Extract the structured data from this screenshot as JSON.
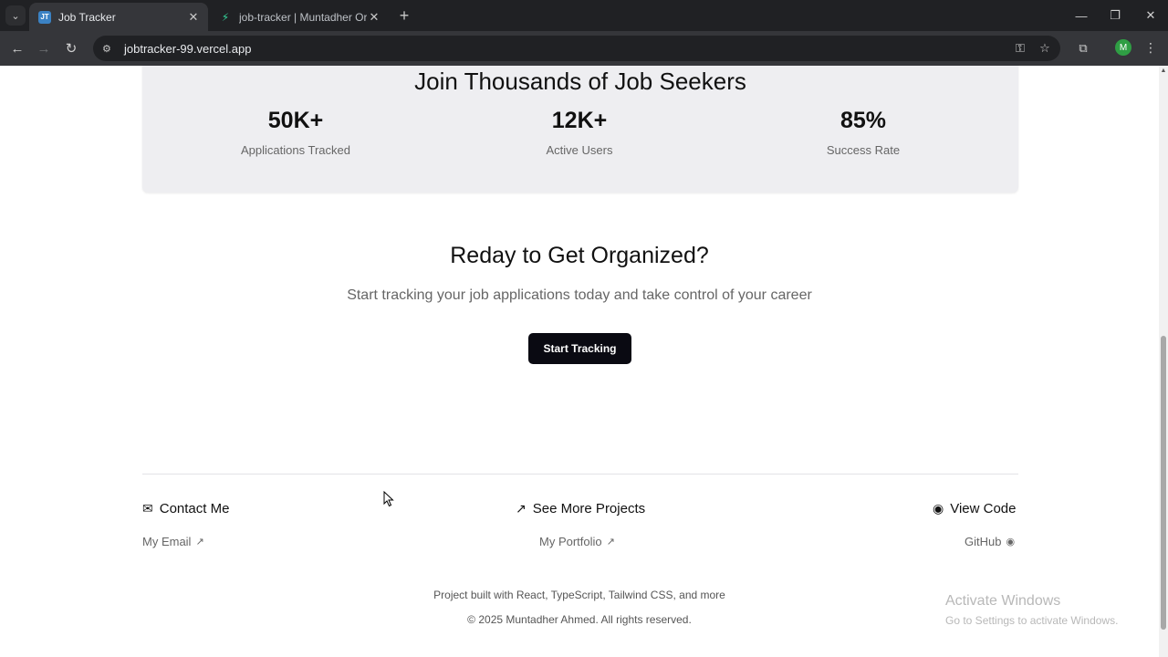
{
  "browser": {
    "tabs": [
      {
        "favicon": "JT",
        "title": "Job Tracker",
        "active": true
      },
      {
        "favicon": "⚡",
        "title": "job-tracker | Muntadher Organi",
        "active": false
      }
    ],
    "url": "jobtracker-99.vercel.app",
    "profile_initial": "M"
  },
  "stats": {
    "title": "Join Thousands of Job Seekers",
    "items": [
      {
        "value": "50K+",
        "label": "Applications Tracked"
      },
      {
        "value": "12K+",
        "label": "Active Users"
      },
      {
        "value": "85%",
        "label": "Success Rate"
      }
    ]
  },
  "cta": {
    "title": "Reday to Get Organized?",
    "subtitle": "Start tracking your job applications today and take control of your career",
    "button": "Start Tracking"
  },
  "footer": {
    "contact": {
      "title": "Contact Me",
      "icon": "mail-icon",
      "link": "My Email"
    },
    "projects": {
      "title": "See More Projects",
      "icon": "external-link-icon",
      "link": "My Portfolio"
    },
    "code": {
      "title": "View Code",
      "icon": "github-icon",
      "link": "GitHub"
    },
    "built_with": "Project built with React, TypeScript, Tailwind CSS, and more",
    "copyright": "© 2025 Muntadher Ahmed. All rights reserved."
  },
  "watermark": {
    "line1": "Activate Windows",
    "line2": "Go to Settings to activate Windows."
  }
}
